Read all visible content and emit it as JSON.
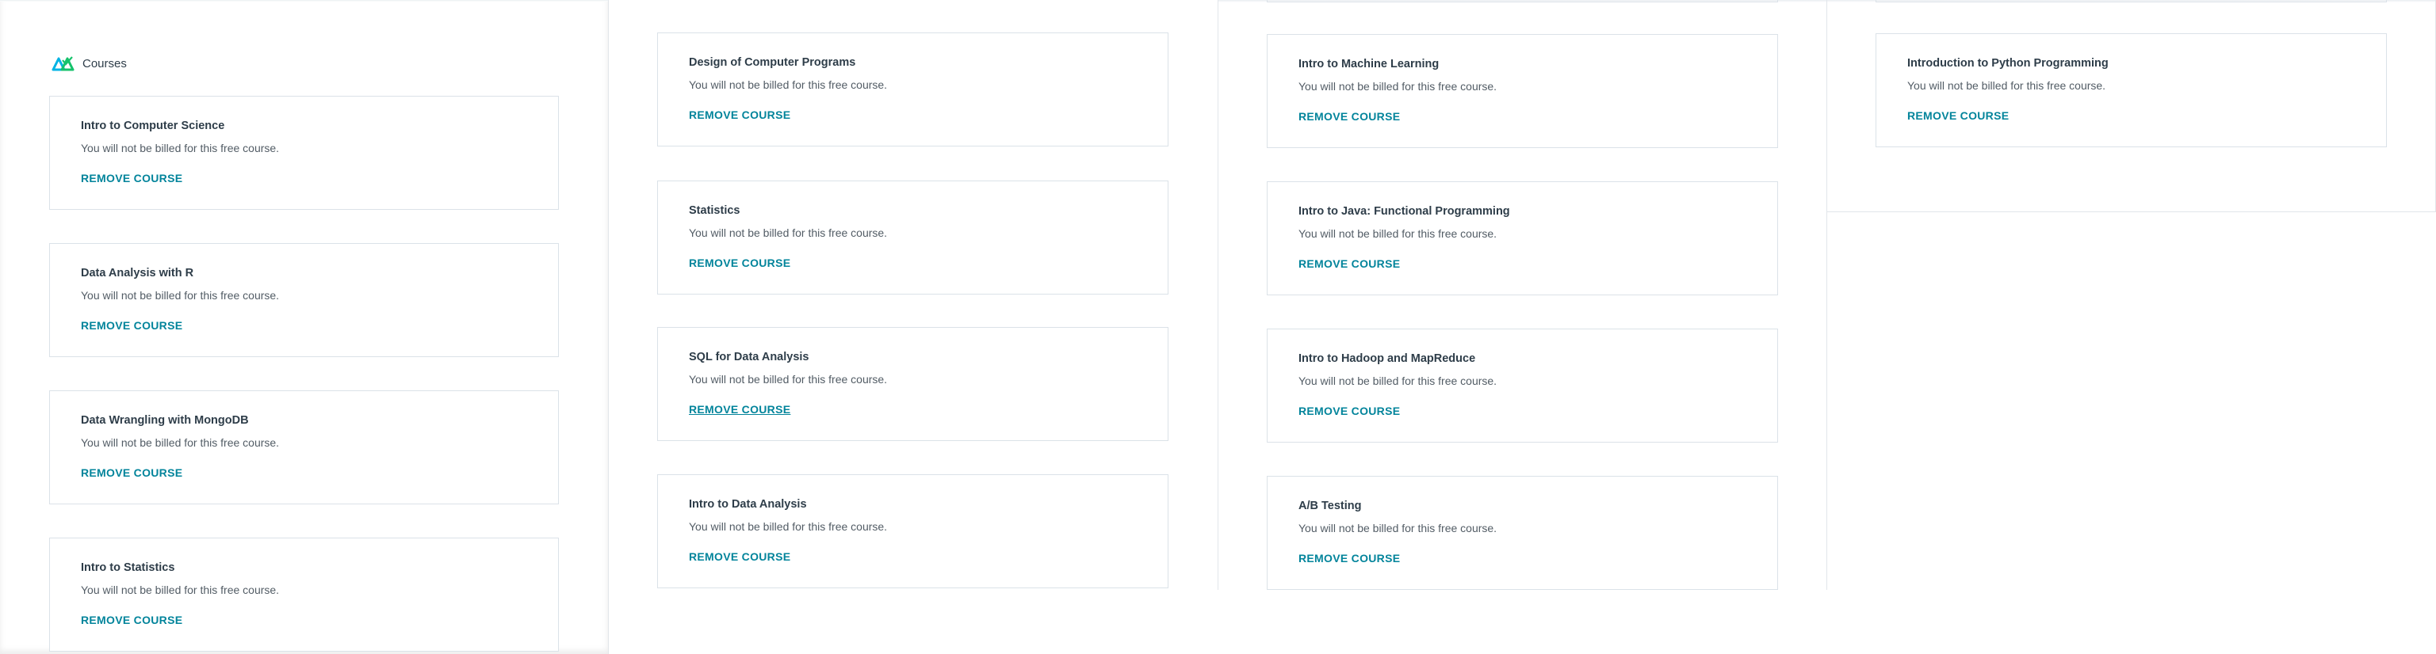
{
  "header": {
    "title": "Courses",
    "icon": "udacity-logo-icon",
    "accent": "#02b3e4"
  },
  "colors": {
    "link": "#02849b",
    "title": "#2e3d49",
    "text": "#525c65",
    "border": "#dbe2e8"
  },
  "common": {
    "billing_note": "You will not be billed for this free course.",
    "remove_label": "REMOVE COURSE"
  },
  "columns": [
    {
      "courses": [
        {
          "title": "Intro to Computer Science",
          "note": "You will not be billed for this free course.",
          "action": "REMOVE COURSE"
        },
        {
          "title": "Data Analysis with R",
          "note": "You will not be billed for this free course.",
          "action": "REMOVE COURSE"
        },
        {
          "title": "Data Wrangling with MongoDB",
          "note": "You will not be billed for this free course.",
          "action": "REMOVE COURSE"
        },
        {
          "title": "Intro to Statistics",
          "note": "You will not be billed for this free course.",
          "action": "REMOVE COURSE"
        }
      ]
    },
    {
      "courses": [
        {
          "title": "Design of Computer Programs",
          "note": "You will not be billed for this free course.",
          "action": "REMOVE COURSE"
        },
        {
          "title": "Statistics",
          "note": "You will not be billed for this free course.",
          "action": "REMOVE COURSE"
        },
        {
          "title": "SQL for Data Analysis",
          "note": "You will not be billed for this free course.",
          "action": "REMOVE COURSE"
        },
        {
          "title": "Intro to Data Analysis",
          "note": "You will not be billed for this free course.",
          "action": "REMOVE COURSE"
        }
      ]
    },
    {
      "courses": [
        {
          "title": "Intro to Machine Learning",
          "note": "You will not be billed for this free course.",
          "action": "REMOVE COURSE"
        },
        {
          "title": "Intro to Java: Functional Programming",
          "note": "You will not be billed for this free course.",
          "action": "REMOVE COURSE"
        },
        {
          "title": "Intro to Hadoop and MapReduce",
          "note": "You will not be billed for this free course.",
          "action": "REMOVE COURSE"
        },
        {
          "title": "A/B Testing",
          "note": "You will not be billed for this free course.",
          "action": "REMOVE COURSE"
        }
      ]
    },
    {
      "courses": [
        {
          "title": "Introduction to Python Programming",
          "note": "You will not be billed for this free course.",
          "action": "REMOVE COURSE"
        }
      ]
    }
  ]
}
